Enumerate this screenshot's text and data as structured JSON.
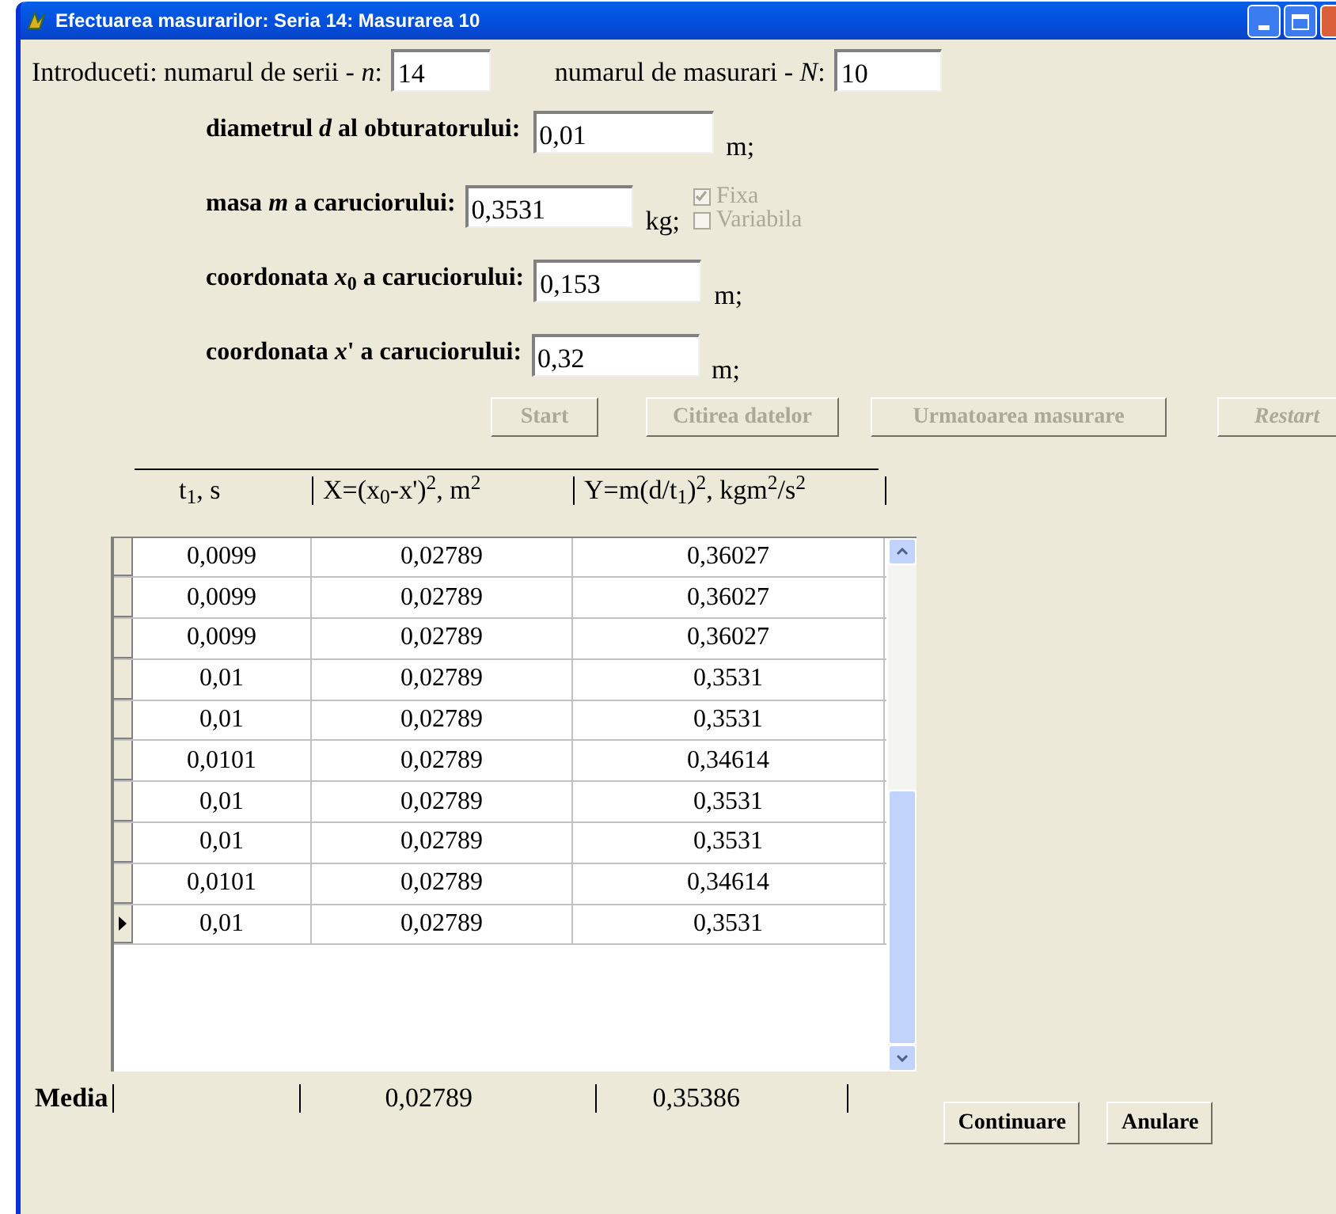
{
  "window": {
    "title": "Efectuarea masurarilor: Seria 14: Masurarea 10"
  },
  "inputs_row": [
    {
      "label": "Introduceti: numarul de serii - *n*:",
      "value": "14"
    },
    {
      "label": "numarul de masurari - *N*:",
      "value": "10"
    }
  ],
  "parameters": [
    {
      "label": "diametrul *d* al obturatorului:",
      "value": "0,01",
      "unit": "m;"
    },
    {
      "label": "masa *m* a caruciorului:",
      "value": "0,3531",
      "unit": "kg;",
      "options": [
        {
          "label": "Fixa",
          "checked": true,
          "disabled": true
        },
        {
          "label": "Variabila",
          "checked": false,
          "disabled": true
        }
      ]
    },
    {
      "label": "coordonata *x*$_{0}$ a caruciorului:",
      "value": "0,153",
      "unit": "m;"
    },
    {
      "label": "coordonata *x*' a caruciorului:",
      "value": "0,32",
      "unit": "m;"
    }
  ],
  "actions": [
    {
      "label": "Start",
      "disabled": true,
      "italic": false
    },
    {
      "label": "Citirea datelor",
      "disabled": true,
      "italic": false
    },
    {
      "label": "Urmatoarea masurare",
      "disabled": true,
      "italic": false
    },
    {
      "label": "Restart",
      "disabled": true,
      "italic": true
    }
  ],
  "table": {
    "columns": [
      "t$_{1}$,  s",
      "X=(x$_{0}$-x')$^{2}$, m$^{2}$",
      "Y=m(d/t$_{1}$)$^{2}$, kgm$^{2}$/s$^{2}$"
    ],
    "rows": [
      {
        "cells": [
          "0,0099",
          "0,02789",
          "0,36027"
        ],
        "selected": false
      },
      {
        "cells": [
          "0,0099",
          "0,02789",
          "0,36027"
        ],
        "selected": false
      },
      {
        "cells": [
          "0,0099",
          "0,02789",
          "0,36027"
        ],
        "selected": false
      },
      {
        "cells": [
          "0,01",
          "0,02789",
          "0,3531"
        ],
        "selected": false
      },
      {
        "cells": [
          "0,01",
          "0,02789",
          "0,3531"
        ],
        "selected": false
      },
      {
        "cells": [
          "0,0101",
          "0,02789",
          "0,34614"
        ],
        "selected": false
      },
      {
        "cells": [
          "0,01",
          "0,02789",
          "0,3531"
        ],
        "selected": false
      },
      {
        "cells": [
          "0,01",
          "0,02789",
          "0,3531"
        ],
        "selected": false
      },
      {
        "cells": [
          "0,0101",
          "0,02789",
          "0,34614"
        ],
        "selected": false
      },
      {
        "cells": [
          "0,01",
          "0,02789",
          "0,3531"
        ],
        "selected": true
      }
    ]
  },
  "summary": {
    "label": "Media",
    "values": [
      "0,02789",
      "0,35386"
    ]
  },
  "buttons": [
    "Continuare",
    "Anulare"
  ]
}
